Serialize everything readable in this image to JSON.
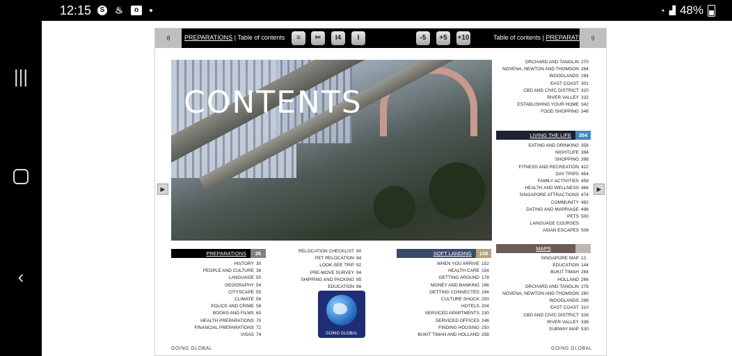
{
  "status_bar": {
    "time": "12:15",
    "battery": "48%"
  },
  "header": {
    "left_page": "8",
    "right_page": "9",
    "left_section": "PREPARATIONS",
    "left_label": "Table of contents",
    "right_label": "Table of contents",
    "right_section": "PREPARATIONS",
    "buttons": [
      "≡",
      "✂",
      "I4",
      "I",
      "-5",
      "+5",
      "+10"
    ]
  },
  "hero": {
    "title": "CONTENTS"
  },
  "col_right_top": [
    {
      "label": "ORCHARD AND TANGLIN",
      "page": "270"
    },
    {
      "label": "NOVENA, NEWTON AND THOMSON",
      "page": "284"
    },
    {
      "label": "WOODLANDS",
      "page": "294"
    },
    {
      "label": "EAST COAST",
      "page": "301"
    },
    {
      "label": "CBD AND CIVIC DISTRICT",
      "page": "320"
    },
    {
      "label": "RIVER VALLEY",
      "page": "332"
    },
    {
      "label": "ESTABLISHING YOUR HOME",
      "page": "342"
    },
    {
      "label": "FOOD SHOPPING",
      "page": "346"
    }
  ],
  "living": {
    "label": "LIVING THE LIFE",
    "num": "354",
    "items": [
      {
        "label": "EATING AND DRINKING",
        "page": "358"
      },
      {
        "label": "NIGHTLIFE",
        "page": "384"
      },
      {
        "label": "SHOPPING",
        "page": "398"
      },
      {
        "label": "FITNESS AND RECREATION",
        "page": "422"
      },
      {
        "label": "DAY TRIPS",
        "page": "454"
      },
      {
        "label": "FAMILY ACTIVITIES",
        "page": "458"
      },
      {
        "label": "HEALTH AND WELLNESS",
        "page": "466"
      },
      {
        "label": "SINGAPORE ATTRACTIONS",
        "page": "474"
      },
      {
        "label": "COMMUNITY",
        "page": "482"
      },
      {
        "label": "DATING AND MARRIAGE",
        "page": "496"
      },
      {
        "label": "PETS",
        "page": "500"
      },
      {
        "label": "LANGUAGE COURSES",
        "page": ""
      },
      {
        "label": "ASIAN ESCAPES",
        "page": "508"
      }
    ]
  },
  "maps": {
    "label": "MAPS",
    "items": [
      {
        "label": "SINGAPORE MAP",
        "page": "12"
      },
      {
        "label": "EDUCATION",
        "page": "144"
      },
      {
        "label": "BUKIT TIMAH",
        "page": "264"
      },
      {
        "label": "HOLLAND",
        "page": "266"
      },
      {
        "label": "ORCHARD AND TANGLIN",
        "page": "278"
      },
      {
        "label": "NOVENA, NEWTON AND THOMSON",
        "page": "290"
      },
      {
        "label": "WOODLANDS",
        "page": "298"
      },
      {
        "label": "EAST COAST",
        "page": "310"
      },
      {
        "label": "CBD AND CIVIC DISTRICT",
        "page": "328"
      },
      {
        "label": "RIVER VALLEY",
        "page": "338"
      },
      {
        "label": "SUBWAY MAP",
        "page": "530"
      }
    ]
  },
  "preparations": {
    "label": "PREPARATIONS",
    "num": "26",
    "items": [
      {
        "label": "HISTORY",
        "page": "30"
      },
      {
        "label": "PEOPLE AND CULTURE",
        "page": "36"
      },
      {
        "label": "LANGUAGE",
        "page": "50"
      },
      {
        "label": "GEOGRAPHY",
        "page": "54"
      },
      {
        "label": "CITYSCAPE",
        "page": "55"
      },
      {
        "label": "CLIMATE",
        "page": "56"
      },
      {
        "label": "POLICE AND CRIME",
        "page": "58"
      },
      {
        "label": "BOOKS AND FILMS",
        "page": "60"
      },
      {
        "label": "HEALTH PREPARATIONS",
        "page": "70"
      },
      {
        "label": "FINANCIAL PREPARATIONS",
        "page": "72"
      },
      {
        "label": "VISAS",
        "page": "74"
      }
    ]
  },
  "middle": [
    {
      "label": "RELOCATION CHECKLIST",
      "page": "80"
    },
    {
      "label": "PET RELOCATION",
      "page": "84"
    },
    {
      "label": "LOOK-SEE TRIP",
      "page": "92"
    },
    {
      "label": "PRE-MOVE SURVEY",
      "page": "94"
    },
    {
      "label": "SHIPPING AND PACKING",
      "page": "95"
    },
    {
      "label": "EDUCATION",
      "page": "96"
    }
  ],
  "soft_landing": {
    "label": "SOFT LANDING",
    "num": "148",
    "items": [
      {
        "label": "WHEN YOU ARRIVE",
        "page": "152"
      },
      {
        "label": "HEALTH CARE",
        "page": "154"
      },
      {
        "label": "GETTING AROUND",
        "page": "178"
      },
      {
        "label": "MONEY AND BANKING",
        "page": "186"
      },
      {
        "label": "GETTING CONNECTED",
        "page": "194"
      },
      {
        "label": "CULTURE SHOCK",
        "page": "200"
      },
      {
        "label": "HOTELS",
        "page": "204"
      },
      {
        "label": "SERVICED APARTMENTS",
        "page": "230"
      },
      {
        "label": "SERVICED OFFICES",
        "page": "246"
      },
      {
        "label": "FINDING HOUSING",
        "page": "250"
      },
      {
        "label": "BUKIT TIMAH AND HOLLAND",
        "page": "258"
      }
    ]
  },
  "logo_text": "GOING GLOBAL",
  "footer": {
    "left": "GOING GLOBAL",
    "right": "GOING GLOBAL"
  },
  "colors": {
    "header_bg": "#000000",
    "prep_num": "#7f7f7f",
    "living_num": "#3a8bbf",
    "soft_num": "#b9a27a",
    "maps_bar": "#6b5d55"
  }
}
